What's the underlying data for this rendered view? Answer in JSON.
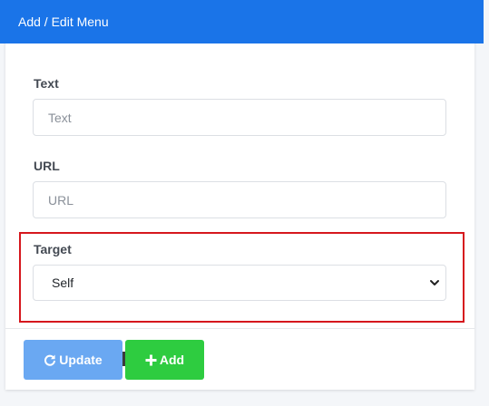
{
  "header": {
    "title": "Add / Edit Menu"
  },
  "form": {
    "text_label": "Text",
    "text_placeholder": "Text",
    "text_value": "",
    "url_label": "URL",
    "url_placeholder": "URL",
    "url_value": "",
    "target_label": "Target",
    "target_selected": "Self"
  },
  "actions": {
    "update_label": "Update",
    "update_icon": "refresh-icon",
    "add_label": "Add",
    "add_icon": "plus-icon"
  },
  "colors": {
    "header_bg": "#1a74e8",
    "update_bg": "#6aa8f2",
    "add_bg": "#2ecc40",
    "highlight_border": "#d6171d"
  }
}
